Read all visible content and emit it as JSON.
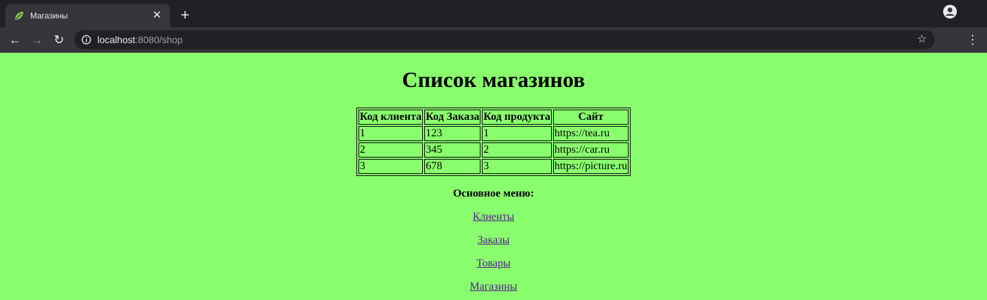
{
  "browser": {
    "tab_title": "Магазины",
    "url_host": "localhost",
    "url_rest": ":8080/shop"
  },
  "page": {
    "title": "Список магазинов",
    "table": {
      "headers": [
        "Код клиента",
        "Код Заказа",
        "Код продукта",
        "Сайт"
      ],
      "rows": [
        [
          "1",
          "123",
          "1",
          "https://tea.ru"
        ],
        [
          "2",
          "345",
          "2",
          "https://car.ru"
        ],
        [
          "3",
          "678",
          "3",
          "https://picture.ru"
        ]
      ]
    },
    "menu": {
      "title": "Основное меню:",
      "links": [
        "Клиенты",
        "Заказы",
        "Товары",
        "Магазины"
      ]
    }
  },
  "colors": {
    "page_background": "#8aff6e",
    "link": "#551a8b"
  }
}
